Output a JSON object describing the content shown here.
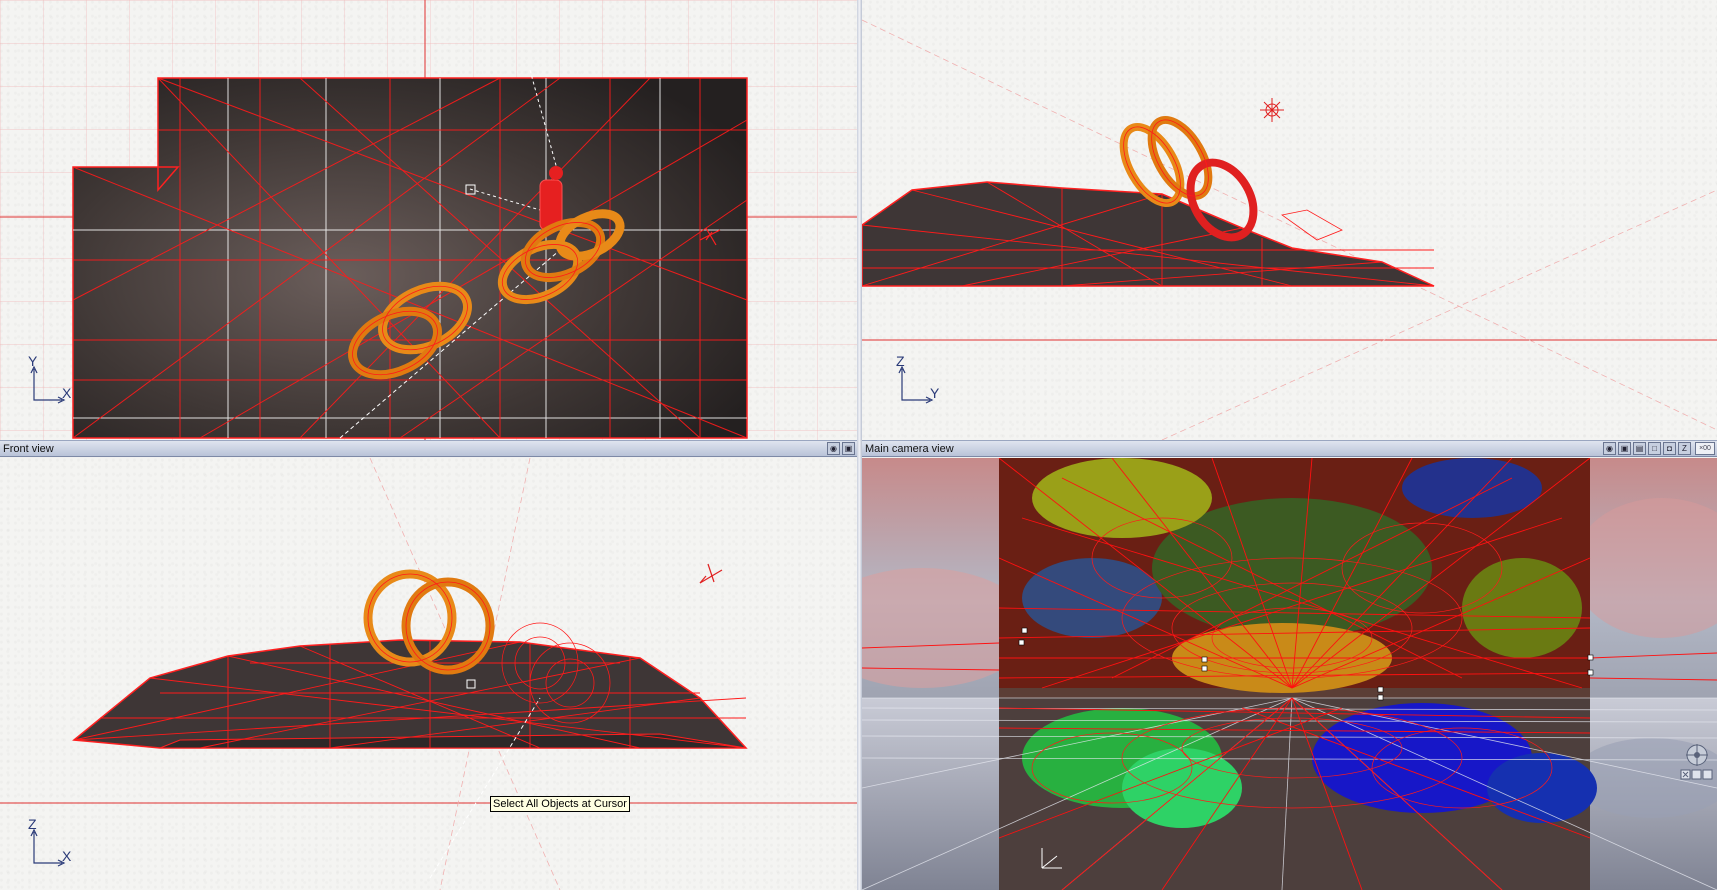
{
  "viewports": {
    "top": {
      "title": "",
      "axis_vertical": "Y",
      "axis_horizontal": "X"
    },
    "right": {
      "title": "",
      "axis_vertical": "Z",
      "axis_horizontal": "Y"
    },
    "front": {
      "title": "Front view",
      "axis_vertical": "Z",
      "axis_horizontal": "X"
    },
    "camera": {
      "title": "Main camera view",
      "zoom_value": "×00"
    }
  },
  "tooltip": {
    "text": "Select All Objects at Cursor"
  },
  "colors": {
    "wire": "#e01010",
    "torus": "#f08a10",
    "floor": "#3c3534",
    "titlebar": "#c2cbdd"
  }
}
